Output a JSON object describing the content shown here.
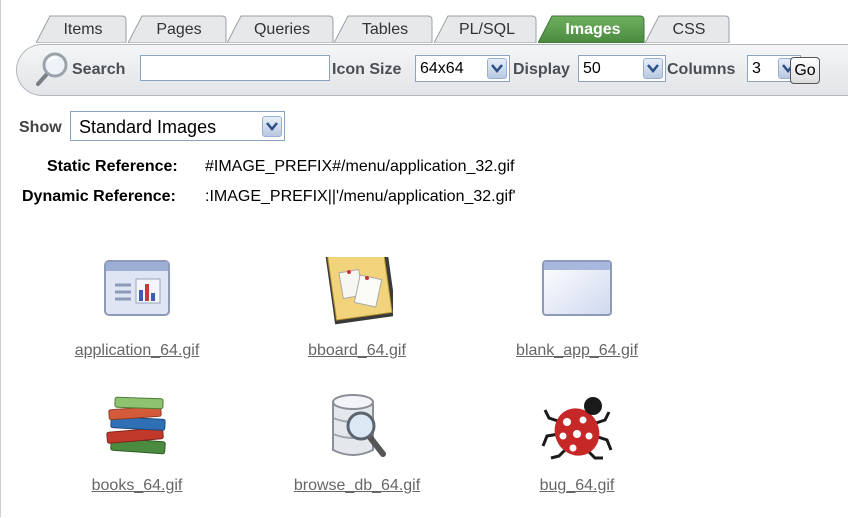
{
  "tabs": [
    {
      "label": "Items",
      "active": false
    },
    {
      "label": "Pages",
      "active": false
    },
    {
      "label": "Queries",
      "active": false
    },
    {
      "label": "Tables",
      "active": false
    },
    {
      "label": "PL/SQL",
      "active": false
    },
    {
      "label": "Images",
      "active": true
    },
    {
      "label": "CSS",
      "active": false
    }
  ],
  "toolbar": {
    "search_label": "Search",
    "search_value": "",
    "icon_size_label": "Icon Size",
    "icon_size_value": "64x64",
    "display_label": "Display",
    "display_value": "50",
    "columns_label": "Columns",
    "columns_value": "3",
    "go_label": "Go"
  },
  "show": {
    "label": "Show",
    "value": "Standard Images"
  },
  "references": {
    "static_label": "Static Reference:",
    "static_value": "#IMAGE_PREFIX#/menu/application_32.gif",
    "dynamic_label": "Dynamic Reference:",
    "dynamic_value": ":IMAGE_PREFIX||'/menu/application_32.gif'"
  },
  "images": [
    {
      "name": "application_64.gif",
      "icon": "application-window-icon"
    },
    {
      "name": "bboard_64.gif",
      "icon": "bulletin-board-icon"
    },
    {
      "name": "blank_app_64.gif",
      "icon": "blank-app-icon"
    },
    {
      "name": "books_64.gif",
      "icon": "books-icon"
    },
    {
      "name": "browse_db_64.gif",
      "icon": "browse-database-icon"
    },
    {
      "name": "bug_64.gif",
      "icon": "ladybug-icon"
    }
  ],
  "colors": {
    "active_tab": "#5a9a4e",
    "tab": "#e6e8ea",
    "link": "#666666"
  }
}
